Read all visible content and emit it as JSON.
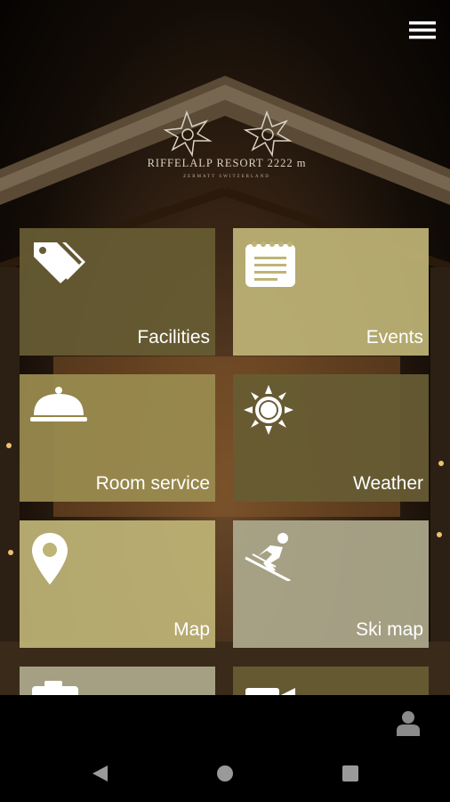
{
  "header": {
    "menu_icon": "hamburger-menu-icon",
    "logo_title": "RIFFELALP RESORT 2222 m",
    "logo_subtitle": "ZERMATT SWITZERLAND"
  },
  "tiles": [
    {
      "label": "Facilities",
      "icon": "price-tags-icon",
      "color": "#675c34"
    },
    {
      "label": "Events",
      "icon": "notepad-icon",
      "color": "#beb476"
    },
    {
      "label": "Room service",
      "icon": "cloche-icon",
      "color": "#9a8c50"
    },
    {
      "label": "Weather",
      "icon": "sun-icon",
      "color": "#675c34"
    },
    {
      "label": "Map",
      "icon": "map-pin-icon",
      "color": "#beb476"
    },
    {
      "label": "Ski map",
      "icon": "skier-icon",
      "color": "#aba78a"
    },
    {
      "label": "",
      "icon": "camera-icon",
      "color": "#aba78a"
    },
    {
      "label": "",
      "icon": "video-camera-icon",
      "color": "#675c34"
    }
  ],
  "bottom_bar": {
    "user_icon": "user-profile-icon"
  },
  "nav": {
    "back_icon": "back-triangle-icon",
    "home_icon": "home-circle-icon",
    "recents_icon": "recents-square-icon"
  }
}
